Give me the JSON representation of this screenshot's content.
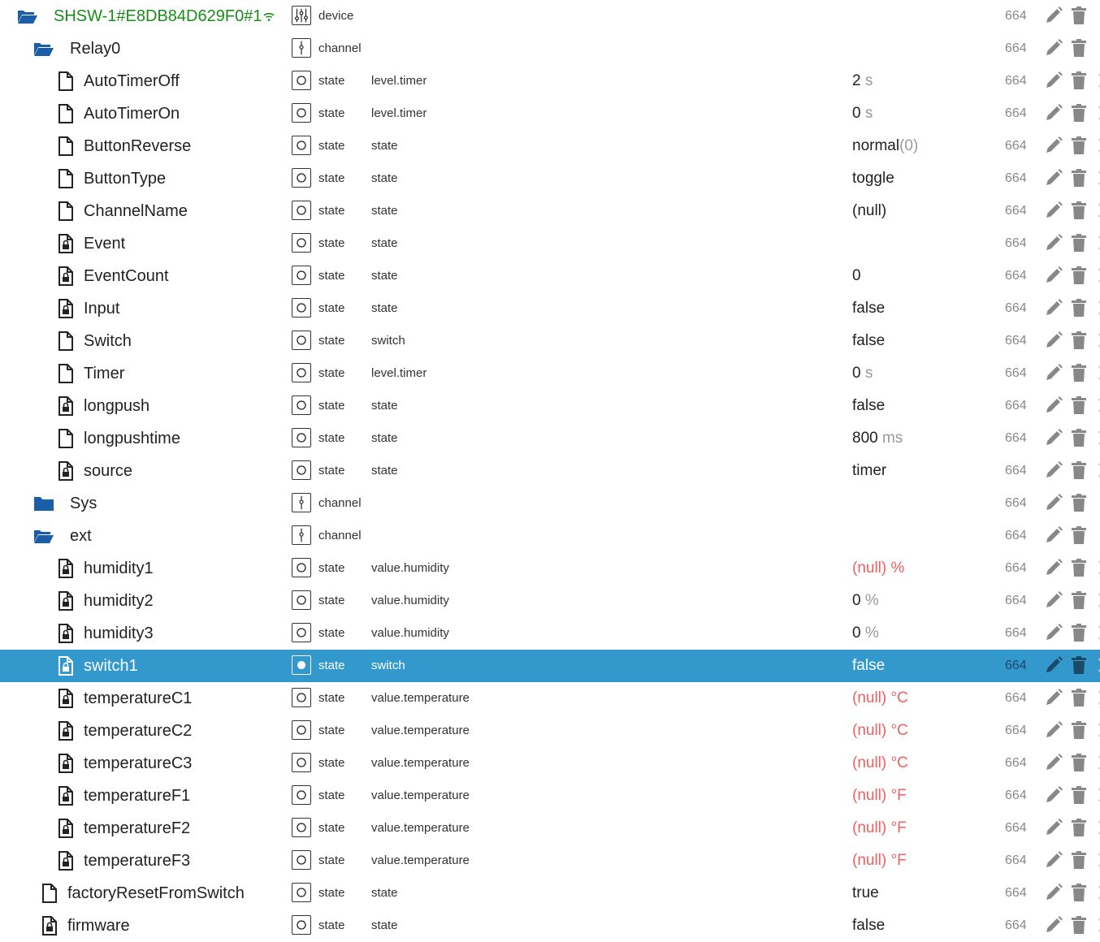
{
  "colors": {
    "selected_bg": "#3399cc",
    "device_name": "#1a8c1a",
    "null_value": "#f06060",
    "folder": "#1a5ea8"
  },
  "rows": [
    {
      "name": "SHSW-1#E8DB84D629F0#1",
      "icon": "folder-open-icon",
      "depth": 0,
      "type": "device",
      "type_icon": "device-sliders-icon",
      "role": "",
      "value": "",
      "unit": "",
      "acl": "664",
      "device": true,
      "wifi": true,
      "extra": false
    },
    {
      "name": "Relay0",
      "icon": "folder-open-icon",
      "depth": 1,
      "type": "channel",
      "type_icon": "channel-icon",
      "role": "",
      "value": "",
      "unit": "",
      "acl": "664",
      "extra": false
    },
    {
      "name": "AutoTimerOff",
      "icon": "file-icon",
      "depth": 2,
      "type": "state",
      "type_icon": "state-icon",
      "role": "level.timer",
      "value": "2",
      "unit": " s",
      "acl": "664",
      "extra": true
    },
    {
      "name": "AutoTimerOn",
      "icon": "file-icon",
      "depth": 2,
      "type": "state",
      "type_icon": "state-icon",
      "role": "level.timer",
      "value": "0",
      "unit": " s",
      "acl": "664",
      "extra": true
    },
    {
      "name": "ButtonReverse",
      "icon": "file-icon",
      "depth": 2,
      "type": "state",
      "type_icon": "state-icon",
      "role": "state",
      "value": "normal",
      "unit": "(0)",
      "acl": "664",
      "extra": true
    },
    {
      "name": "ButtonType",
      "icon": "file-icon",
      "depth": 2,
      "type": "state",
      "type_icon": "state-icon",
      "role": "state",
      "value": "toggle",
      "unit": "",
      "acl": "664",
      "extra": true
    },
    {
      "name": "ChannelName",
      "icon": "file-icon",
      "depth": 2,
      "type": "state",
      "type_icon": "state-icon",
      "role": "state",
      "value": "(null)",
      "unit": "",
      "acl": "664",
      "extra": true
    },
    {
      "name": "Event",
      "icon": "locked-file-icon",
      "depth": 2,
      "type": "state",
      "type_icon": "state-icon",
      "role": "state",
      "value": "",
      "unit": "",
      "acl": "664",
      "extra": true
    },
    {
      "name": "EventCount",
      "icon": "locked-file-icon",
      "depth": 2,
      "type": "state",
      "type_icon": "state-icon",
      "role": "state",
      "value": "0",
      "unit": "",
      "acl": "664",
      "extra": true
    },
    {
      "name": "Input",
      "icon": "locked-file-icon",
      "depth": 2,
      "type": "state",
      "type_icon": "state-icon",
      "role": "state",
      "value": "false",
      "unit": "",
      "acl": "664",
      "extra": true
    },
    {
      "name": "Switch",
      "icon": "file-icon",
      "depth": 2,
      "type": "state",
      "type_icon": "state-icon",
      "role": "switch",
      "value": "false",
      "unit": "",
      "acl": "664",
      "extra": true
    },
    {
      "name": "Timer",
      "icon": "file-icon",
      "depth": 2,
      "type": "state",
      "type_icon": "state-icon",
      "role": "level.timer",
      "value": "0",
      "unit": " s",
      "acl": "664",
      "extra": true
    },
    {
      "name": "longpush",
      "icon": "locked-file-icon",
      "depth": 2,
      "type": "state",
      "type_icon": "state-icon",
      "role": "state",
      "value": "false",
      "unit": "",
      "acl": "664",
      "extra": true
    },
    {
      "name": "longpushtime",
      "icon": "file-icon",
      "depth": 2,
      "type": "state",
      "type_icon": "state-icon",
      "role": "state",
      "value": "800",
      "unit": " ms",
      "acl": "664",
      "extra": true
    },
    {
      "name": "source",
      "icon": "locked-file-icon",
      "depth": 2,
      "type": "state",
      "type_icon": "state-icon",
      "role": "state",
      "value": "timer",
      "unit": "",
      "acl": "664",
      "extra": true
    },
    {
      "name": "Sys",
      "icon": "folder-closed-icon",
      "depth": 1,
      "type": "channel",
      "type_icon": "channel-icon",
      "role": "",
      "value": "",
      "unit": "",
      "acl": "664",
      "extra": false
    },
    {
      "name": "ext",
      "icon": "folder-open-icon",
      "depth": 1,
      "type": "channel",
      "type_icon": "channel-icon",
      "role": "",
      "value": "",
      "unit": "",
      "acl": "664",
      "extra": false
    },
    {
      "name": "humidity1",
      "icon": "locked-file-icon",
      "depth": 2,
      "type": "state",
      "type_icon": "state-icon",
      "role": "value.humidity",
      "value": "(null)",
      "unit": " %",
      "acl": "664",
      "null": true,
      "extra": true
    },
    {
      "name": "humidity2",
      "icon": "locked-file-icon",
      "depth": 2,
      "type": "state",
      "type_icon": "state-icon",
      "role": "value.humidity",
      "value": "0",
      "unit": " %",
      "acl": "664",
      "extra": true
    },
    {
      "name": "humidity3",
      "icon": "locked-file-icon",
      "depth": 2,
      "type": "state",
      "type_icon": "state-icon",
      "role": "value.humidity",
      "value": "0",
      "unit": " %",
      "acl": "664",
      "extra": true
    },
    {
      "name": "switch1",
      "icon": "locked-file-icon",
      "depth": 2,
      "type": "state",
      "type_icon": "state-icon",
      "role": "switch",
      "value": "false",
      "unit": "",
      "acl": "664",
      "selected": true,
      "extra": true
    },
    {
      "name": "temperatureC1",
      "icon": "locked-file-icon",
      "depth": 2,
      "type": "state",
      "type_icon": "state-icon",
      "role": "value.temperature",
      "value": "(null)",
      "unit": " °C",
      "acl": "664",
      "null": true,
      "extra": true
    },
    {
      "name": "temperatureC2",
      "icon": "locked-file-icon",
      "depth": 2,
      "type": "state",
      "type_icon": "state-icon",
      "role": "value.temperature",
      "value": "(null)",
      "unit": " °C",
      "acl": "664",
      "null": true,
      "extra": true
    },
    {
      "name": "temperatureC3",
      "icon": "locked-file-icon",
      "depth": 2,
      "type": "state",
      "type_icon": "state-icon",
      "role": "value.temperature",
      "value": "(null)",
      "unit": " °C",
      "acl": "664",
      "null": true,
      "extra": true
    },
    {
      "name": "temperatureF1",
      "icon": "locked-file-icon",
      "depth": 2,
      "type": "state",
      "type_icon": "state-icon",
      "role": "value.temperature",
      "value": "(null)",
      "unit": " °F",
      "acl": "664",
      "null": true,
      "extra": true
    },
    {
      "name": "temperatureF2",
      "icon": "locked-file-icon",
      "depth": 2,
      "type": "state",
      "type_icon": "state-icon",
      "role": "value.temperature",
      "value": "(null)",
      "unit": " °F",
      "acl": "664",
      "null": true,
      "extra": true
    },
    {
      "name": "temperatureF3",
      "icon": "locked-file-icon",
      "depth": 2,
      "type": "state",
      "type_icon": "state-icon",
      "role": "value.temperature",
      "value": "(null)",
      "unit": " °F",
      "acl": "664",
      "null": true,
      "extra": true
    },
    {
      "name": "factoryResetFromSwitch",
      "icon": "file-icon",
      "depth": 1.5,
      "type": "state",
      "type_icon": "state-icon",
      "role": "state",
      "value": "true",
      "unit": "",
      "acl": "664",
      "extra": true
    },
    {
      "name": "firmware",
      "icon": "locked-file-icon",
      "depth": 1.5,
      "type": "state",
      "type_icon": "state-icon",
      "role": "state",
      "value": "false",
      "unit": "",
      "acl": "664",
      "extra": true
    }
  ]
}
